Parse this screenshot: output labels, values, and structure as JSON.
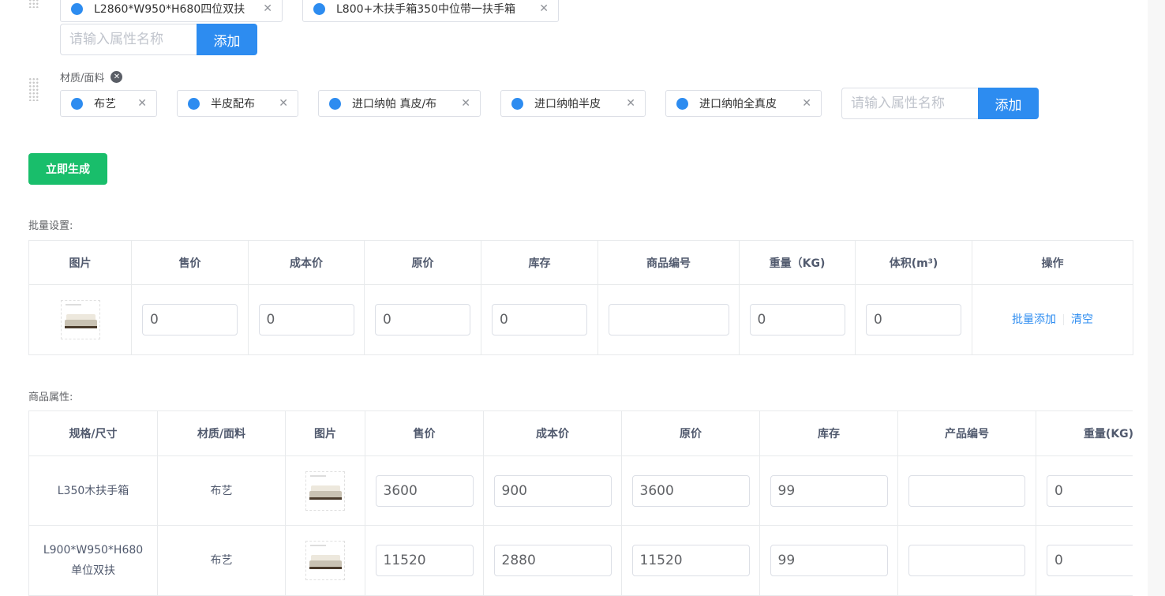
{
  "spec_group": {
    "tags": [
      {
        "label": "L2860*W950*H680四位双扶"
      },
      {
        "label": "L800+木扶手箱350中位带一扶手箱"
      }
    ],
    "input_placeholder": "请输入属性名称",
    "add_label": "添加"
  },
  "material_group": {
    "name": "材质/面料",
    "tags": [
      {
        "label": "布艺"
      },
      {
        "label": "半皮配布"
      },
      {
        "label": "进口纳帕 真皮/布"
      },
      {
        "label": "进口纳帕半皮"
      },
      {
        "label": "进口纳帕全真皮"
      }
    ],
    "input_placeholder": "请输入属性名称",
    "add_label": "添加"
  },
  "generate_label": "立即生成",
  "batch": {
    "label": "批量设置:",
    "headers": [
      "图片",
      "售价",
      "成本价",
      "原价",
      "库存",
      "商品编号",
      "重量（KG)",
      "体积(m³)",
      "操作"
    ],
    "values": {
      "price": "0",
      "cost": "0",
      "original": "0",
      "stock": "0",
      "code": "",
      "weight": "0",
      "volume": "0"
    },
    "batch_add": "批量添加",
    "clear": "清空"
  },
  "attrs": {
    "label": "商品属性:",
    "headers": [
      "规格/尺寸",
      "材质/面料",
      "图片",
      "售价",
      "成本价",
      "原价",
      "库存",
      "产品编号",
      "重量(KG)"
    ],
    "rows": [
      {
        "spec": "L350木扶手箱",
        "material": "布艺",
        "price": "3600",
        "cost": "900",
        "original": "3600",
        "stock": "99",
        "code": "",
        "weight": "0"
      },
      {
        "spec": "L900*W950*H680单位双扶",
        "material": "布艺",
        "price": "11520",
        "cost": "2880",
        "original": "11520",
        "stock": "99",
        "code": "",
        "weight": "0"
      }
    ]
  },
  "icons": {
    "tag_close": "close-icon",
    "group_delete": "circle-close-icon",
    "drag": "drag-handle-icon"
  },
  "colors": {
    "primary": "#2d8cf0",
    "success": "#19be6b"
  }
}
